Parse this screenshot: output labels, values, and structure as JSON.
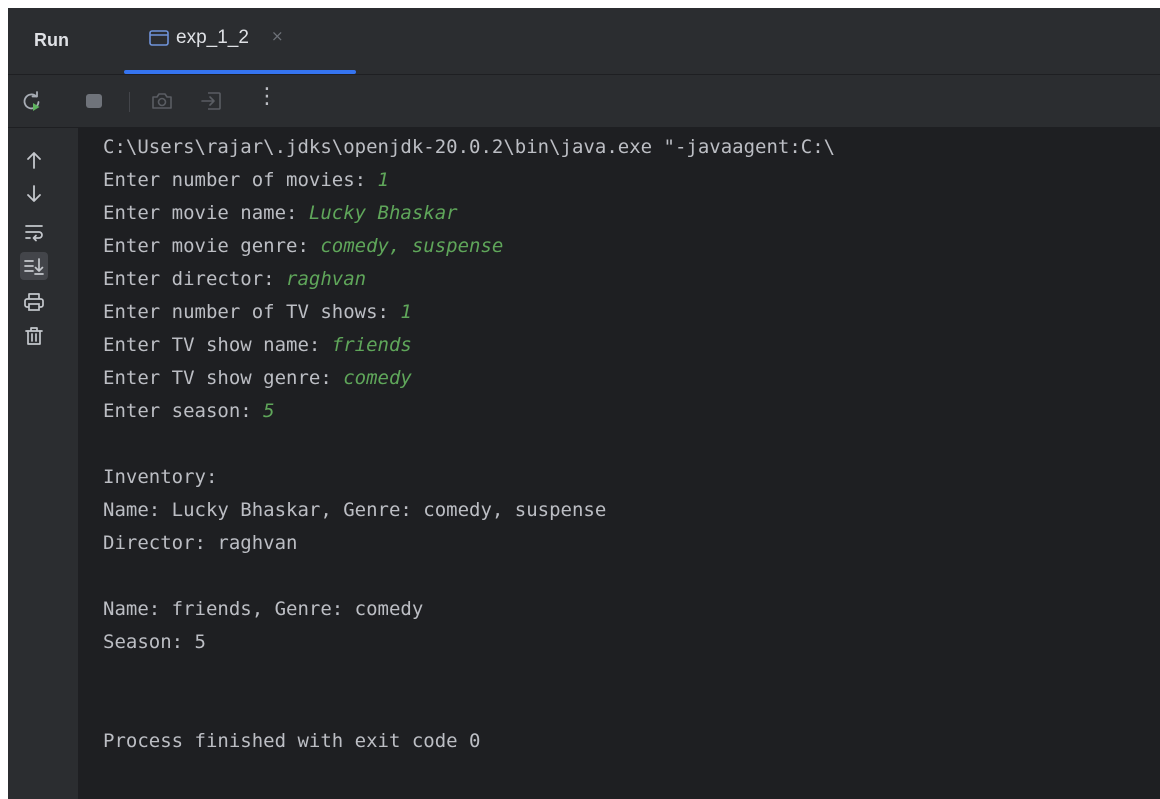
{
  "header": {
    "run_label": "Run",
    "tab_title": "exp_1_2",
    "tab_close": "×"
  },
  "toolbar": {
    "buttons": [
      "rerun-icon",
      "stop-icon",
      "screenshot-icon",
      "restore-layout-icon",
      "more-icon"
    ],
    "more_glyph": "⋮"
  },
  "gutter": {
    "buttons": [
      "up-arrow-icon",
      "down-arrow-icon",
      "soft-wrap-icon",
      "scroll-to-end-icon",
      "print-icon",
      "trash-icon"
    ]
  },
  "console": {
    "command": "C:\\Users\\rajar\\.jdks\\openjdk-20.0.2\\bin\\java.exe \"-javaagent:C:\\",
    "prompts": [
      {
        "label": "Enter number of movies: ",
        "value": "1"
      },
      {
        "label": "Enter movie name: ",
        "value": "Lucky Bhaskar"
      },
      {
        "label": "Enter movie genre: ",
        "value": "comedy, suspense"
      },
      {
        "label": "Enter director: ",
        "value": "raghvan"
      },
      {
        "label": "Enter number of TV shows: ",
        "value": "1"
      },
      {
        "label": "Enter TV show name: ",
        "value": "friends"
      },
      {
        "label": "Enter TV show genre: ",
        "value": "comedy"
      },
      {
        "label": "Enter season: ",
        "value": "5"
      }
    ],
    "inventory_header": "Inventory:",
    "movie_line": "Name: Lucky Bhaskar, Genre: comedy, suspense",
    "director_line": "Director: raghvan",
    "tv_line": "Name: friends, Genre: comedy",
    "season_line": "Season: 5",
    "exit_line": "Process finished with exit code 0"
  },
  "colors": {
    "background": "#1e1f22",
    "panel": "#2b2d30",
    "text": "#bcbec4",
    "user_input": "#5fa65a",
    "accent": "#3574f0"
  }
}
